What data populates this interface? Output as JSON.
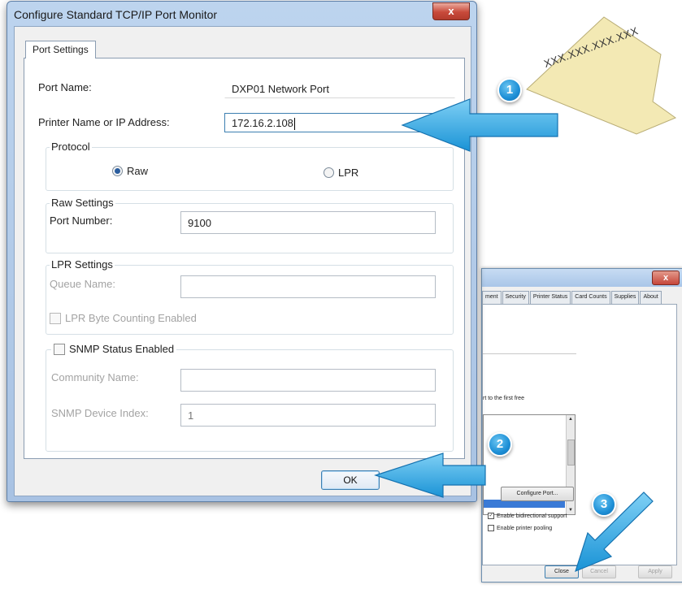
{
  "dialog": {
    "title": "Configure Standard TCP/IP Port Monitor",
    "close_label": "x",
    "tab_label": "Port Settings",
    "port_name_label": "Port Name:",
    "port_name_value": "DXP01 Network Port",
    "printer_label": "Printer Name or IP Address:",
    "printer_value": "172.16.2.108",
    "protocol": {
      "title": "Protocol",
      "raw_label": "Raw",
      "lpr_label": "LPR",
      "selected": "Raw"
    },
    "raw_settings": {
      "title": "Raw Settings",
      "port_number_label": "Port Number:",
      "port_number_value": "9100"
    },
    "lpr_settings": {
      "title": "LPR Settings",
      "queue_name_label": "Queue Name:",
      "queue_name_value": "",
      "byte_counting_label": "LPR Byte Counting Enabled"
    },
    "snmp": {
      "status_label": "SNMP Status Enabled",
      "community_label": "Community Name:",
      "community_value": "",
      "device_index_label": "SNMP Device Index:",
      "device_index_value": "1"
    },
    "ok_label": "OK"
  },
  "background_window": {
    "tabs": [
      "ment",
      "Security",
      "Printer Status",
      "Card Counts",
      "Supplies",
      "About"
    ],
    "partial_text": "rt to the first free",
    "configure_port_label": "Configure Port...",
    "bidirectional_label": "Enable bidirectional support",
    "bidirectional_checked": true,
    "pooling_label": "Enable printer pooling",
    "pooling_checked": false,
    "close_label": "Close",
    "cancel_label": "Cancel",
    "apply_label": "Apply",
    "close_x": "x"
  },
  "note": {
    "text": "XXX.XXX.XXX.XXX"
  },
  "callouts": [
    "1",
    "2",
    "3"
  ],
  "colors": {
    "arrow": "#2aa7e0",
    "note": "#f3e9b4",
    "titlebar": "#b6cfec",
    "window_close": "#c84a3b"
  }
}
